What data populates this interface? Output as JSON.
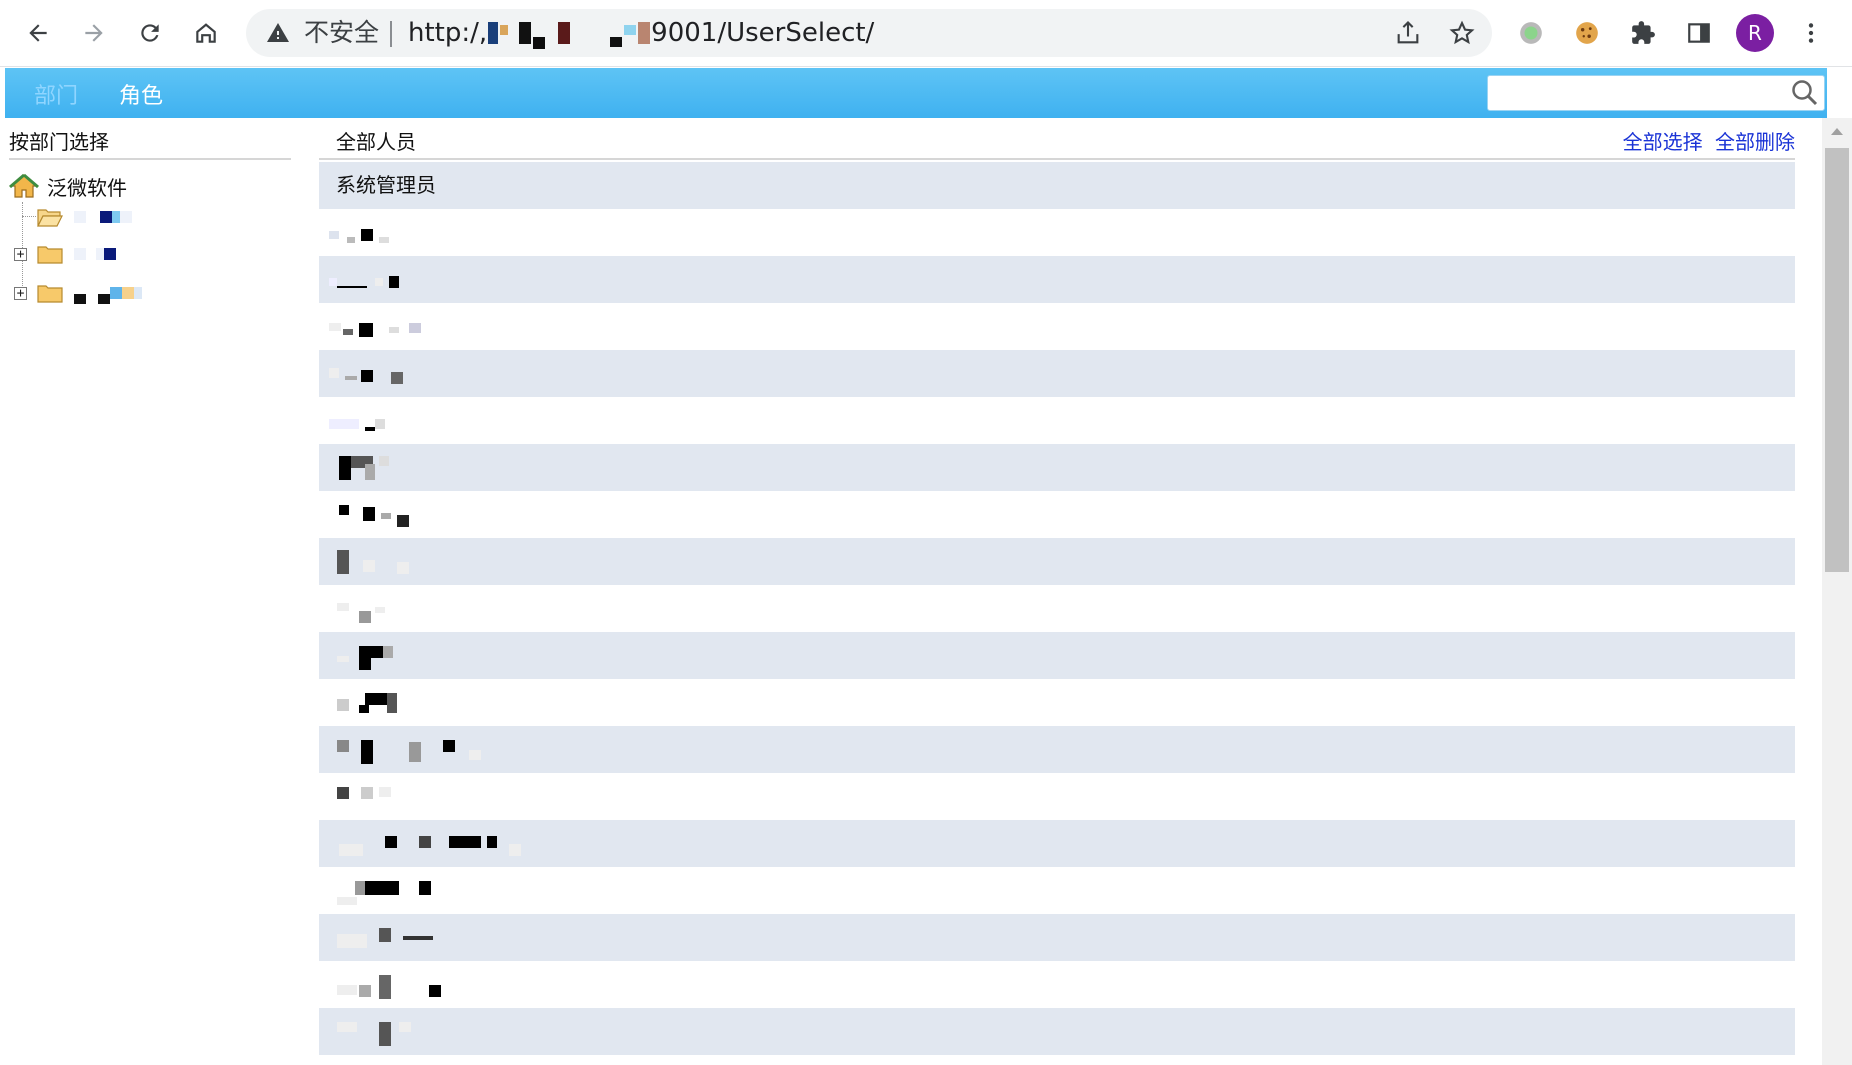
{
  "browser": {
    "security_label": "不安全",
    "url_prefix": "http:/,",
    "url_suffix": "9001/UserSelect/",
    "profile_initial": "R",
    "colors": {
      "profile": "#7b1fa2",
      "omnibox": "#f1f3f4"
    }
  },
  "nav": {
    "tabs": [
      {
        "label": "部门",
        "active": false
      },
      {
        "label": "角色",
        "active": true
      }
    ],
    "search": {
      "value": "",
      "placeholder": ""
    }
  },
  "left_panel": {
    "header": "按部门选择",
    "root_label": "泛微软件",
    "nodes": [
      {
        "expander": "",
        "icon": "folder-open-icon"
      },
      {
        "expander": "+",
        "icon": "folder-icon"
      },
      {
        "expander": "+",
        "icon": "folder-icon"
      }
    ]
  },
  "right_panel": {
    "header": "全部人员",
    "select_all": "全部选择",
    "delete_all": "全部删除",
    "rows": [
      {
        "label": "系统管理员"
      },
      {
        "label": ""
      },
      {
        "label": ""
      },
      {
        "label": ""
      },
      {
        "label": ""
      },
      {
        "label": ""
      },
      {
        "label": ""
      },
      {
        "label": ""
      },
      {
        "label": ""
      },
      {
        "label": ""
      },
      {
        "label": ""
      },
      {
        "label": ""
      },
      {
        "label": ""
      },
      {
        "label": ""
      },
      {
        "label": ""
      },
      {
        "label": ""
      },
      {
        "label": ""
      },
      {
        "label": ""
      },
      {
        "label": ""
      }
    ]
  },
  "colors": {
    "nav_bar": "#3fb1f0",
    "row_alt": "#e1e7f0",
    "link": "#1a33d6"
  }
}
